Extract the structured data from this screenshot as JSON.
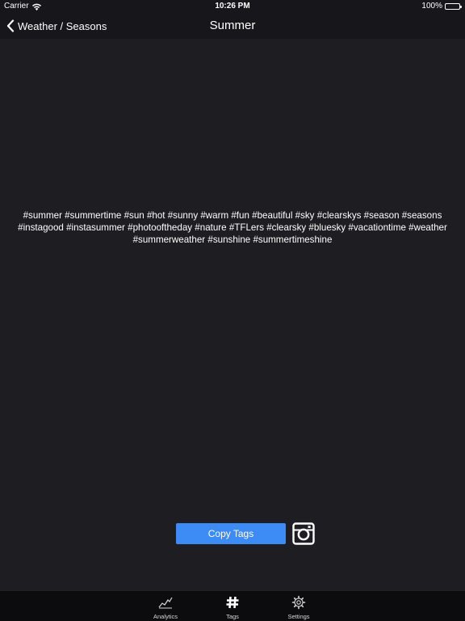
{
  "status_bar": {
    "carrier": "Carrier",
    "time": "10:26 PM",
    "battery": "100%"
  },
  "nav": {
    "back_label": "Weather / Seasons",
    "title": "Summer"
  },
  "content": {
    "tags": "#summer #summertime #sun #hot #sunny #warm #fun #beautiful #sky #clearskys #season #seasons #instagood #instasummer #photooftheday #nature #TFLers #clearsky #bluesky #vacationtime #weather #summerweather #sunshine #summertimeshine"
  },
  "actions": {
    "copy_label": "Copy Tags",
    "share_icon": "instagram-icon"
  },
  "tab_bar": {
    "tabs": [
      {
        "label": "Analytics",
        "icon": "chart-line-icon"
      },
      {
        "label": "Tags",
        "icon": "hashtag-icon"
      },
      {
        "label": "Settings",
        "icon": "gear-icon"
      }
    ]
  },
  "colors": {
    "background": "#1e1d22",
    "bar": "#17161b",
    "accent": "#3d8bf5",
    "tab_bar": "#0c0c0e"
  }
}
